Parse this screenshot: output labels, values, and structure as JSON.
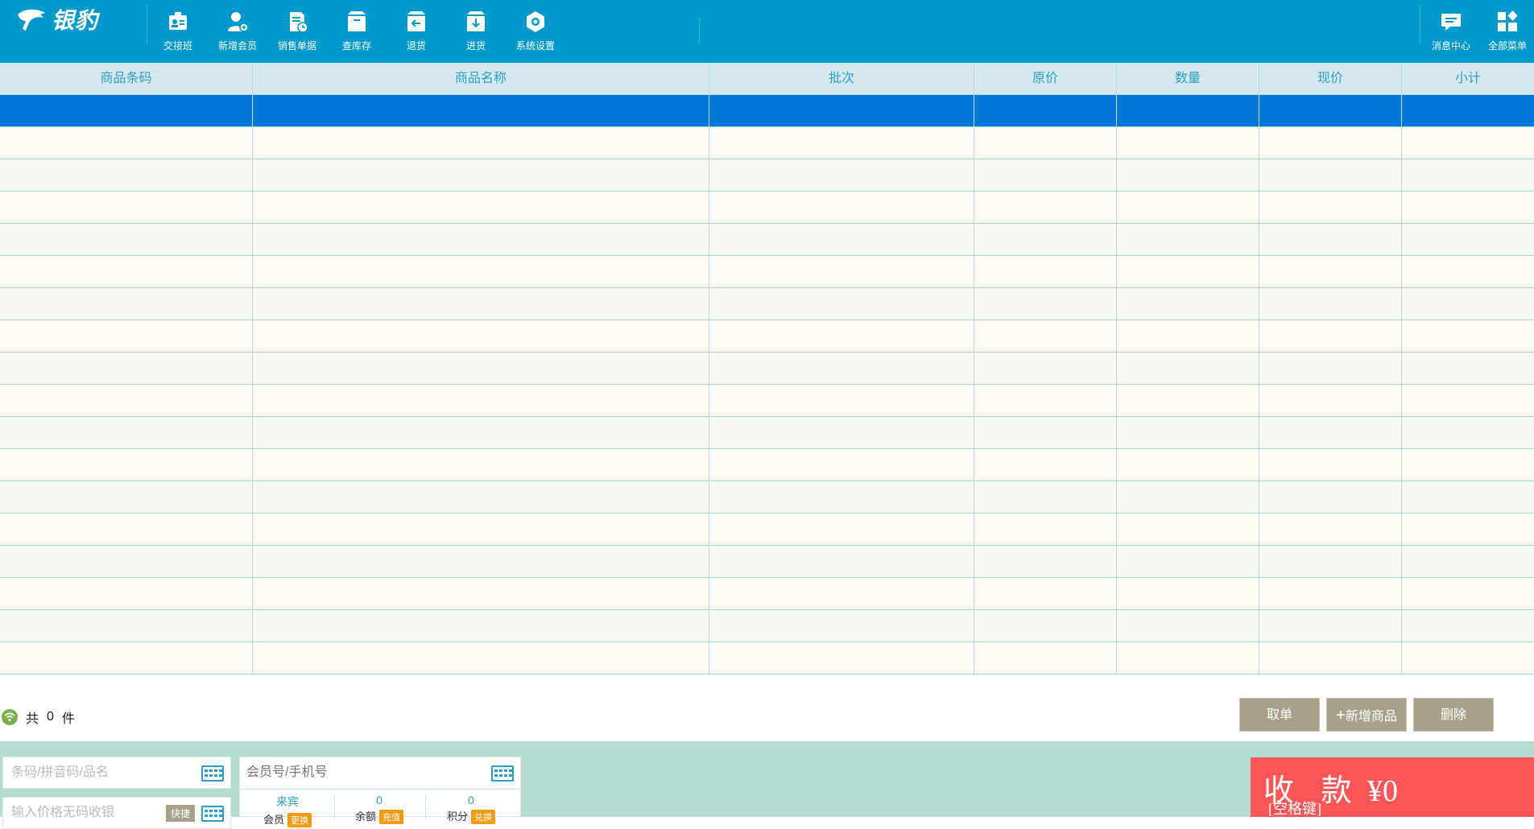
{
  "app": {
    "logo_text": "银豹"
  },
  "toolbar": {
    "items": [
      {
        "label": "交接班",
        "icon": "shift-handover-icon"
      },
      {
        "label": "新增会员",
        "icon": "add-member-icon"
      },
      {
        "label": "销售单据",
        "icon": "sales-receipt-icon"
      },
      {
        "label": "查库存",
        "icon": "inventory-box-icon"
      },
      {
        "label": "退货",
        "icon": "return-goods-icon"
      },
      {
        "label": "进货",
        "icon": "purchase-goods-icon"
      },
      {
        "label": "系统设置",
        "icon": "settings-gear-icon"
      }
    ],
    "right_items": [
      {
        "label": "消息中心",
        "icon": "message-icon"
      },
      {
        "label": "全部菜单",
        "icon": "all-menu-icon"
      }
    ]
  },
  "table": {
    "columns": [
      "商品条码",
      "商品名称",
      "批次",
      "原价",
      "数量",
      "现价",
      "小计"
    ],
    "rows": []
  },
  "summary": {
    "prefix": "共",
    "count": "0",
    "suffix": "件"
  },
  "actions": {
    "cancel_order": "取单",
    "add_product": "新增商品",
    "delete": "删除"
  },
  "search": {
    "barcode_placeholder": "条码/拼音码/品名",
    "price_placeholder": "输入价格无码收银",
    "quick_label": "快捷"
  },
  "member": {
    "placeholder": "会员号/手机号",
    "stats": [
      {
        "value": "来宾",
        "key": "会员",
        "tag": "更换"
      },
      {
        "value": "0",
        "key": "余额",
        "tag": "充值"
      },
      {
        "value": "0",
        "key": "积分",
        "tag": "兑换"
      }
    ]
  },
  "payment": {
    "label": "收 款",
    "hint": "[空格键]",
    "amount": "¥0"
  },
  "colors": {
    "topbar": "#0099cc",
    "selected_row": "#0077d9",
    "pay_button": "#ff5757",
    "action_button": "#a7a18a",
    "bottom_panel": "#b3dcd2"
  }
}
